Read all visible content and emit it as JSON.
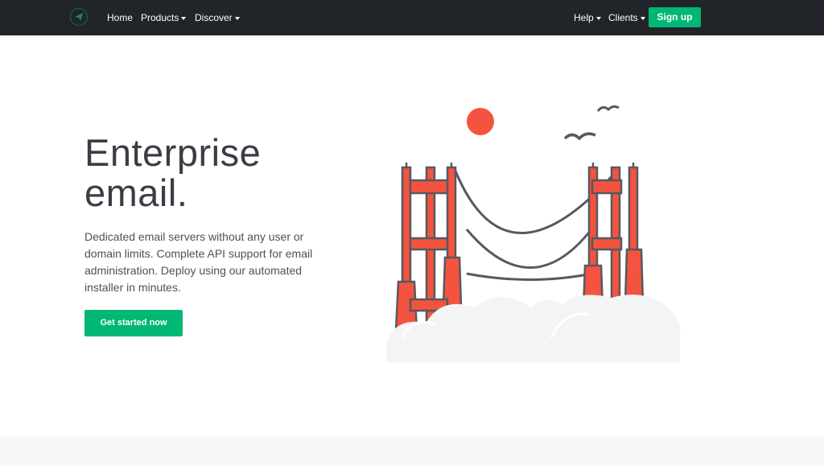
{
  "nav": {
    "logo_icon": "paper-plane-icon",
    "home": "Home",
    "products": "Products",
    "discover": "Discover",
    "help": "Help",
    "clients": "Clients",
    "signup": "Sign up"
  },
  "hero": {
    "title_line1": "Enterprise",
    "title_line2": "email.",
    "description": "Dedicated email servers without any user or domain limits. Complete API support for email administration. Deploy using our automated installer in minutes.",
    "cta": "Get started now"
  },
  "colors": {
    "navbar": "#212428",
    "accent": "#00b774",
    "bridge": "#f4533f",
    "outline": "#555a61"
  }
}
